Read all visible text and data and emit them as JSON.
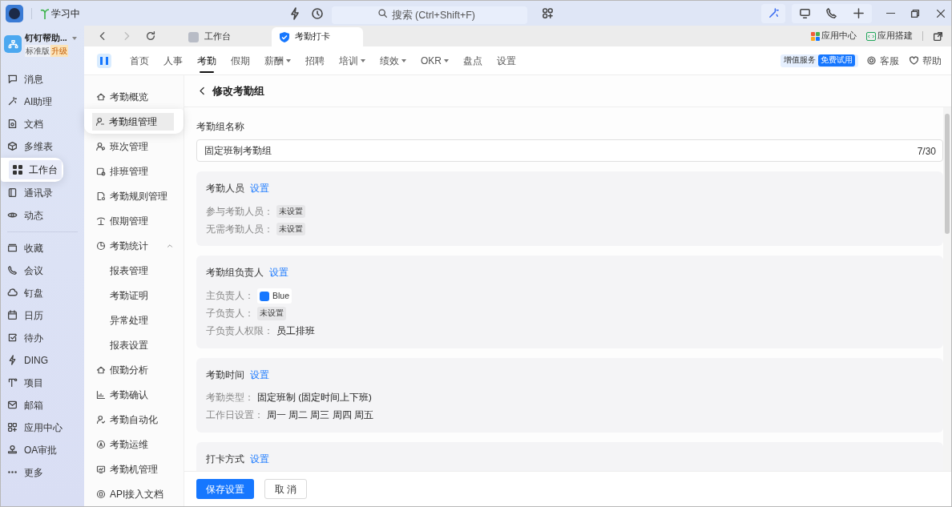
{
  "title_bar": {
    "status": "学习中",
    "search": {
      "placeholder": "搜索 (Ctrl+Shift+F)"
    }
  },
  "org": {
    "name": "钉钉帮助...",
    "edition": "标准版",
    "upgrade": "升级"
  },
  "sidebar": {
    "groups": [
      [
        {
          "label": "消息",
          "selected": false
        },
        {
          "label": "AI助理",
          "selected": false
        },
        {
          "label": "文档",
          "selected": false
        },
        {
          "label": "多维表",
          "selected": false
        },
        {
          "label": "工作台",
          "selected": true
        },
        {
          "label": "通讯录",
          "selected": false
        },
        {
          "label": "动态",
          "selected": false
        }
      ],
      [
        {
          "label": "收藏",
          "selected": false
        },
        {
          "label": "会议",
          "selected": false
        },
        {
          "label": "钉盘",
          "selected": false
        },
        {
          "label": "日历",
          "selected": false
        },
        {
          "label": "待办",
          "selected": false
        },
        {
          "label": "DING",
          "selected": false
        },
        {
          "label": "项目",
          "selected": false
        },
        {
          "label": "邮箱",
          "selected": false
        },
        {
          "label": "应用中心",
          "selected": false
        },
        {
          "label": "OA审批",
          "selected": false
        },
        {
          "label": "更多",
          "selected": false
        }
      ]
    ]
  },
  "browser_tabs": [
    {
      "label": "工作台",
      "selected": false
    },
    {
      "label": "考勤打卡",
      "selected": true
    }
  ],
  "toolbar_links": [
    "应用中心",
    "应用搭建"
  ],
  "app_nav": {
    "items": [
      {
        "label": "首页",
        "selected": false,
        "dropdown": false
      },
      {
        "label": "人事",
        "selected": false,
        "dropdown": false
      },
      {
        "label": "考勤",
        "selected": true,
        "dropdown": false
      },
      {
        "label": "假期",
        "selected": false,
        "dropdown": false
      },
      {
        "label": "薪酬",
        "selected": false,
        "dropdown": true
      },
      {
        "label": "招聘",
        "selected": false,
        "dropdown": false
      },
      {
        "label": "培训",
        "selected": false,
        "dropdown": true
      },
      {
        "label": "绩效",
        "selected": false,
        "dropdown": true
      },
      {
        "label": "OKR",
        "selected": false,
        "dropdown": true
      },
      {
        "label": "盘点",
        "selected": false,
        "dropdown": false
      },
      {
        "label": "设置",
        "selected": false,
        "dropdown": false
      }
    ],
    "service": "增值服务",
    "trial": "免费试用",
    "support": "客服",
    "help": "帮助"
  },
  "sub_nav": [
    {
      "label": "考勤概览",
      "selected": false
    },
    {
      "label": "考勤组管理",
      "selected": true
    },
    {
      "label": "班次管理",
      "selected": false
    },
    {
      "label": "排班管理",
      "selected": false
    },
    {
      "label": "考勤规则管理",
      "selected": false
    },
    {
      "label": "假期管理",
      "selected": false
    },
    {
      "label": "考勤统计",
      "selected": false,
      "expanded": true,
      "children": [
        {
          "label": "报表管理",
          "selected": false
        },
        {
          "label": "考勤证明",
          "selected": false
        },
        {
          "label": "异常处理",
          "selected": false
        },
        {
          "label": "报表设置",
          "selected": false
        }
      ]
    },
    {
      "label": "假勤分析",
      "selected": false
    },
    {
      "label": "考勤确认",
      "selected": false
    },
    {
      "label": "考勤自动化",
      "selected": false
    },
    {
      "label": "考勤运维",
      "selected": false
    },
    {
      "label": "考勤机管理",
      "selected": false
    },
    {
      "label": "API接入文档",
      "selected": false
    }
  ],
  "page": {
    "title": "修改考勤组",
    "name_label": "考勤组名称",
    "name_value": "固定班制考勤组",
    "name_count": "7/30",
    "sections": [
      {
        "title": "考勤人员",
        "link": "设置",
        "rows": [
          {
            "label": "参与考勤人员：",
            "kind": "tag",
            "value": "未设置"
          },
          {
            "label": "无需考勤人员：",
            "kind": "tag",
            "value": "未设置"
          }
        ]
      },
      {
        "title": "考勤组负责人",
        "link": "设置",
        "rows": [
          {
            "label": "主负责人：",
            "kind": "user",
            "value": "Blue"
          },
          {
            "label": "子负责人：",
            "kind": "tag",
            "value": "未设置"
          },
          {
            "label": "子负责人权限：",
            "kind": "text",
            "value": "员工排班"
          }
        ]
      },
      {
        "title": "考勤时间",
        "link": "设置",
        "rows": [
          {
            "label": "考勤类型：",
            "kind": "text",
            "value": "固定班制 (固定时间上下班)"
          },
          {
            "label": "工作日设置：",
            "kind": "text",
            "value": "周一 周二 周三 周四 周五"
          }
        ]
      },
      {
        "title": "打卡方式",
        "link": "设置"
      }
    ],
    "save": "保存设置",
    "cancel": "取 消"
  }
}
